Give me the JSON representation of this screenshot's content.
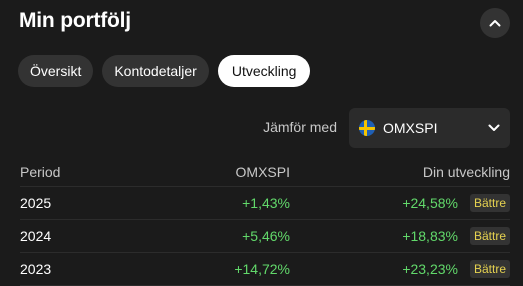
{
  "header": {
    "title": "Min portfölj"
  },
  "tabs": [
    {
      "label": "Översikt",
      "active": false
    },
    {
      "label": "Kontodetaljer",
      "active": false
    },
    {
      "label": "Utveckling",
      "active": true
    }
  ],
  "compare": {
    "label": "Jämför med",
    "selected": "OMXSPI",
    "flag": "sweden-flag-icon"
  },
  "table": {
    "columns": [
      "Period",
      "OMXSPI",
      "Din utveckling"
    ],
    "rows": [
      {
        "period": "2025",
        "index": "+1,43%",
        "yours": "+24,58%",
        "badge": "Bättre"
      },
      {
        "period": "2024",
        "index": "+5,46%",
        "yours": "+18,83%",
        "badge": "Bättre"
      },
      {
        "period": "2023",
        "index": "+14,72%",
        "yours": "+23,23%",
        "badge": "Bättre"
      }
    ]
  },
  "colors": {
    "background": "#1b1b1b",
    "positive": "#62d96b",
    "badge_text": "#e6d250"
  }
}
